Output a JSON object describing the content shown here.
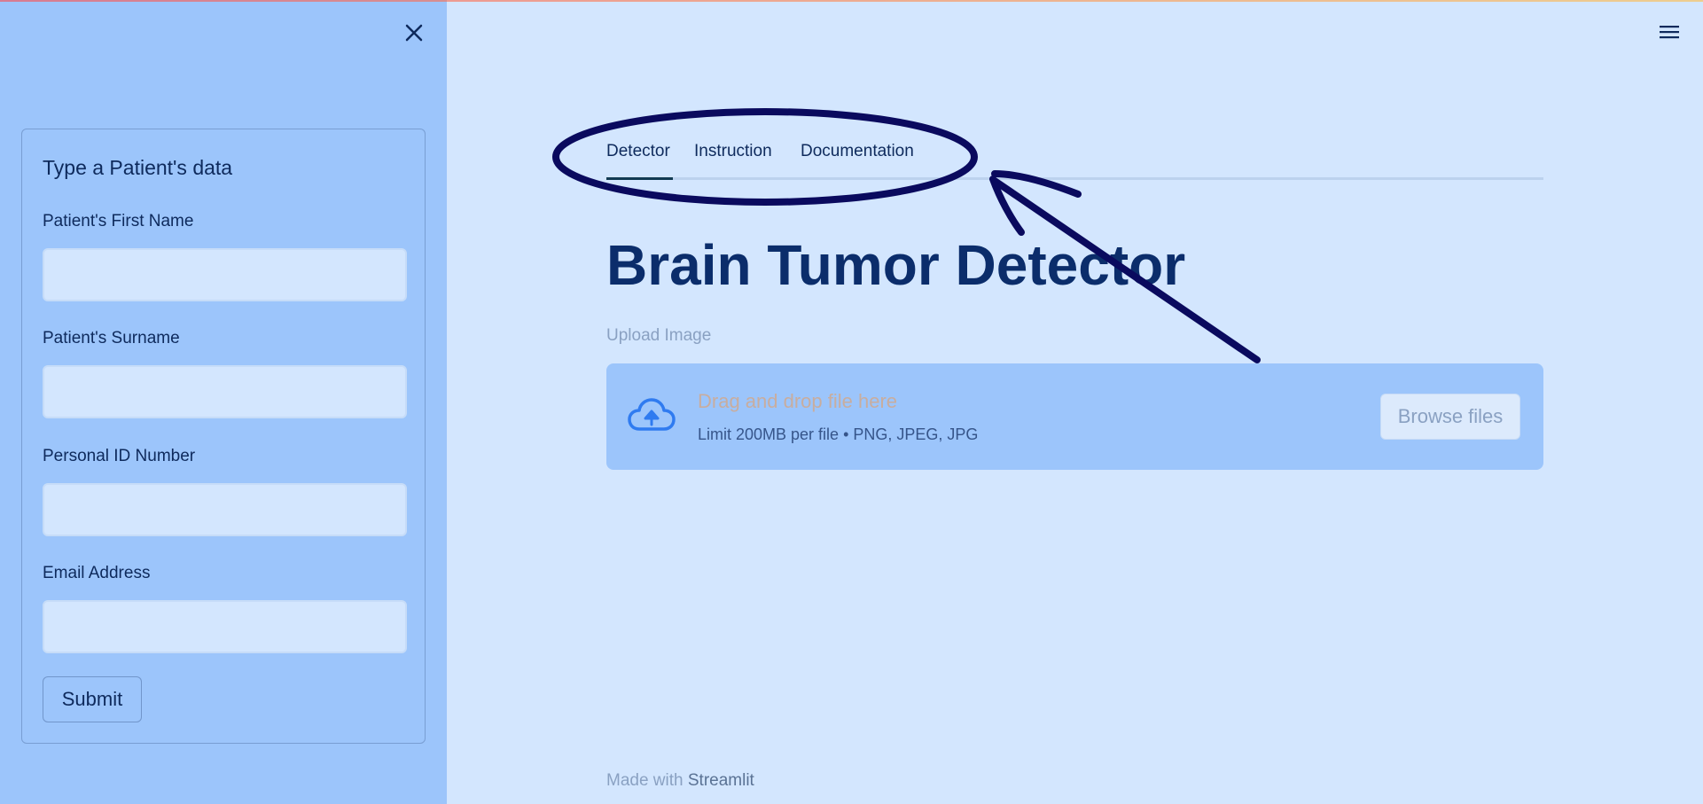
{
  "sidebar": {
    "close_icon": "close-icon",
    "form": {
      "title": "Type a Patient's data",
      "fields": [
        {
          "label": "Patient's First Name",
          "value": "",
          "placeholder": ""
        },
        {
          "label": "Patient's Surname",
          "value": "",
          "placeholder": ""
        },
        {
          "label": "Personal ID Number",
          "value": "",
          "placeholder": ""
        },
        {
          "label": "Email Address",
          "value": "",
          "placeholder": ""
        }
      ],
      "submit_label": "Submit"
    }
  },
  "header": {
    "menu_icon": "hamburger-menu-icon"
  },
  "main": {
    "tabs": [
      {
        "label": "Detector",
        "active": true
      },
      {
        "label": "Instruction",
        "active": false
      },
      {
        "label": "Documentation",
        "active": false
      }
    ],
    "title": "Brain Tumor Detector",
    "uploader": {
      "label": "Upload Image",
      "dropzone_text": "Drag and drop file here",
      "limit_text": "Limit 200MB per file • PNG, JPEG, JPG",
      "browse_label": "Browse files",
      "icon": "cloud-upload-icon"
    },
    "footer": {
      "prefix": "Made with ",
      "brand": "Streamlit"
    }
  },
  "colors": {
    "sidebar_bg": "#9cc5fb",
    "main_bg": "#d3e6fe",
    "title": "#0b2d6b",
    "annotation": "#0a0a5e",
    "upload_icon": "#2f7bf0"
  }
}
